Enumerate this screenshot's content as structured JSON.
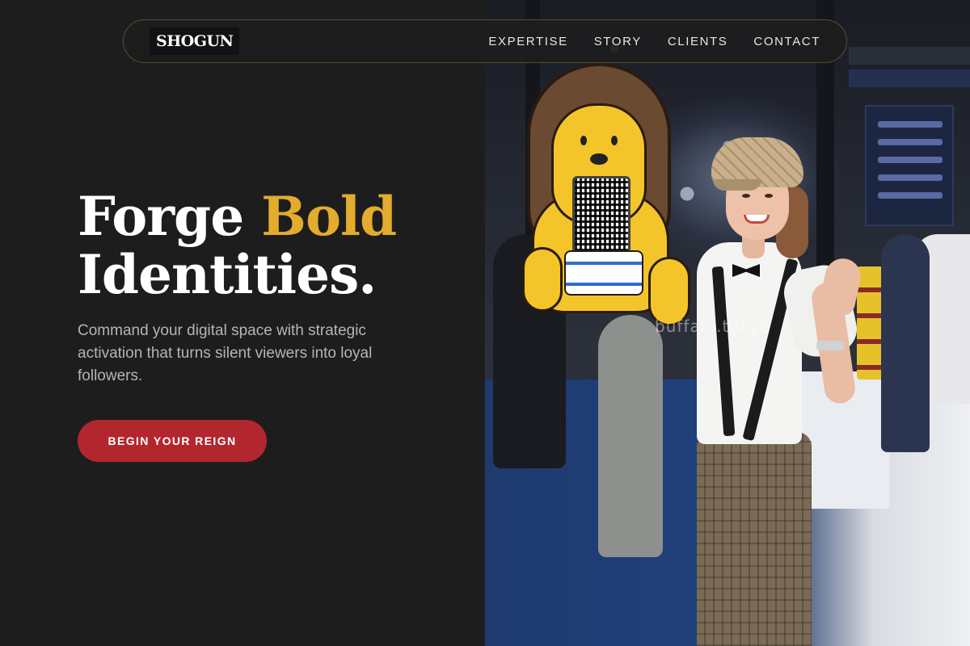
{
  "brand": {
    "logo_text": "SHOGUN"
  },
  "nav": {
    "items": [
      {
        "label": "EXPERTISE"
      },
      {
        "label": "STORY"
      },
      {
        "label": "CLIENTS"
      },
      {
        "label": "CONTACT"
      }
    ]
  },
  "hero": {
    "title_line1_plain": "Forge ",
    "title_line1_accent": "Bold",
    "title_line2": "Identities.",
    "subtitle": "Command your digital space with strategic activation that turns silent viewers into loyal followers.",
    "cta_label": "BEGIN YOUR REIGN"
  },
  "photo": {
    "watermark": "buffalo.tokyo"
  },
  "colors": {
    "background": "#1e1d1e",
    "accent_gold": "#e3ac2e",
    "cta_red": "#b2272e",
    "nav_border": "#5a4a2a"
  }
}
